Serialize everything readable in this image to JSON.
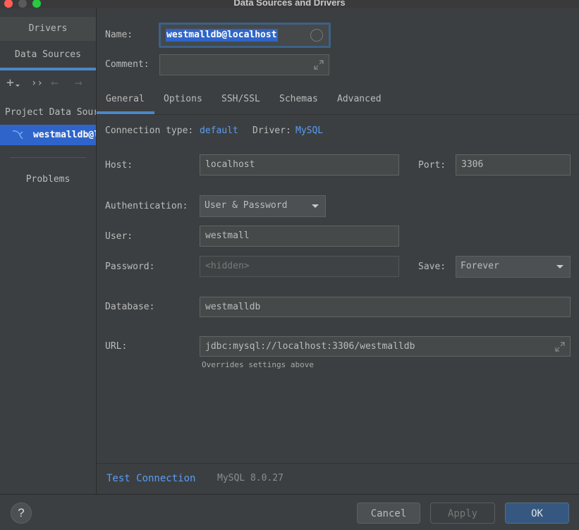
{
  "window": {
    "title": "Data Sources and Drivers"
  },
  "sidebar": {
    "tabs": [
      "Drivers",
      "Data Sources"
    ],
    "toolbar": {
      "add": "+",
      "more": "››",
      "back": "←",
      "forward": "→"
    },
    "tree_header": "Project Data Sources",
    "item": "westmalldb@localhost",
    "problems": "Problems"
  },
  "form": {
    "name_label": "Name:",
    "name_value": "westmalldb@localhost",
    "comment_label": "Comment:",
    "comment_value": ""
  },
  "tabs": [
    "General",
    "Options",
    "SSH/SSL",
    "Schemas",
    "Advanced"
  ],
  "general": {
    "connection_type_label": "Connection type:",
    "connection_type_value": "default",
    "driver_label": "Driver:",
    "driver_value": "MySQL",
    "host_label": "Host:",
    "host_value": "localhost",
    "port_label": "Port:",
    "port_value": "3306",
    "auth_label": "Authentication:",
    "auth_value": "User & Password",
    "user_label": "User:",
    "user_value": "westmall",
    "password_label": "Password:",
    "password_placeholder": "<hidden>",
    "save_label": "Save:",
    "save_value": "Forever",
    "database_label": "Database:",
    "database_value": "westmalldb",
    "url_label": "URL:",
    "url_value": "jdbc:mysql://localhost:3306/westmalldb",
    "url_hint": "Overrides settings above"
  },
  "footer": {
    "test_connection": "Test Connection",
    "version": "MySQL 8.0.27"
  },
  "buttons": {
    "help": "?",
    "cancel": "Cancel",
    "apply": "Apply",
    "ok": "OK"
  },
  "colors": {
    "accent": "#4a88c7",
    "selection": "#2f65ca",
    "link": "#589df6",
    "close": "#ff5f57",
    "minimize": "#febc2e",
    "zoom": "#28c840"
  }
}
